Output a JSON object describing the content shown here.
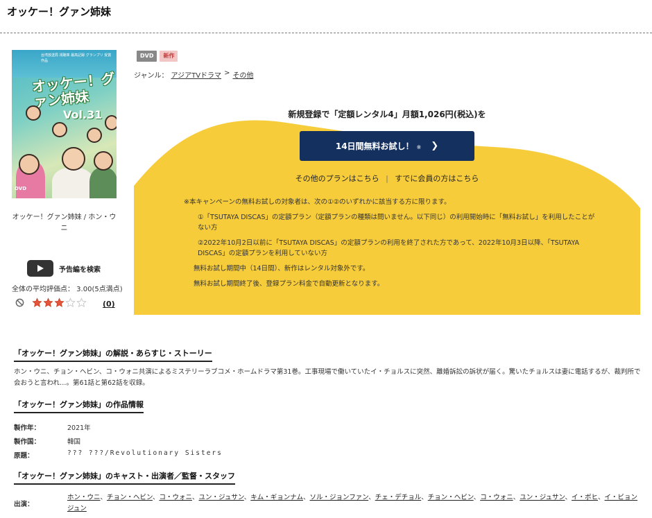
{
  "page": {
    "title": "オッケー！グァン姉妹"
  },
  "cover": {
    "header_text": "台湾放送局 視聴率 最高記録 グランプリ 受賞作品",
    "title_text": "オッケー！グァン姉妹",
    "vol_text": "Vol.31",
    "dvd_mark": "DVD"
  },
  "sidebar": {
    "work_title": "オッケー！グァン姉妹 / ホン・ウニ",
    "trailer_label": "予告編を検索",
    "avg_rating": "全体の平均評価点： 3.00(5点満点)",
    "rating_value": 3,
    "rating_max": 5,
    "review_count": "(0)"
  },
  "badges": {
    "dvd": "DVD",
    "new": "新作"
  },
  "genre": {
    "label": "ジャンル：",
    "item1": "アジアTVドラマ",
    "sep": ">",
    "item2": "その他"
  },
  "campaign": {
    "headline": "新規登録で「定額レンタル4」月額1,026円(税込)を",
    "button_label": "14日間無料お試し！",
    "button_mark": "※",
    "other_plans": "その他のプランはこちら",
    "divider": "|",
    "member_link": "すでに会員の方はこちら",
    "note_intro": "※本キャンペーンの無料お試しの対象者は、次の①②のいずれかに該当する方に限ります。",
    "note1": "①「TSUTAYA DISCAS」の定額プラン（定額プランの種類は問いません。以下同じ）の利用開始時に「無料お試し」を利用したことがない方",
    "note2": "②2022年10月2日以前に「TSUTAYA DISCAS」の定額プランの利用を終了された方であって、2022年10月3日以降、「TSUTAYA DISCAS」の定額プランを利用していない方",
    "note3": "無料お試し期間中（14日間）、新作はレンタル対象外です。",
    "note4": "無料お試し期間終了後、登録プラン料金で自動更新となります。"
  },
  "synopsis": {
    "heading": "「オッケー！グァン姉妹」の解説・あらすじ・ストーリー",
    "text": "ホン・ウニ、チョン・ヘビン、コ・ウォニ共演によるミステリーラブコメ・ホームドラマ第31巻。工事現場で働いていたイ・チョルスに突然、離婚訴訟の訴状が届く。驚いたチョルスは妻に電話するが、裁判所で会おうと言われ…。第61話と第62話を収録。"
  },
  "info": {
    "heading": "「オッケー！グァン姉妹」の作品情報",
    "year_label": "製作年：",
    "year_value": "2021年",
    "country_label": "製作国：",
    "country_value": "韓国",
    "original_label": "原題：",
    "original_value": "??? ???/Revolutionary Sisters"
  },
  "cast": {
    "heading": "「オッケー！グァン姉妹」のキャスト・出演者／監督・スタッフ",
    "label": "出演：",
    "names": [
      "ホン・ウニ",
      "チョン・ヘビン",
      "コ・ウォニ",
      "ユン・ジュサン",
      "キム・ギョンナム",
      "ソル・ジョンファン",
      "チェ・デチョル",
      "チョン・ヘビン",
      "コ・ウォニ",
      "ユン・ジュサン",
      "イ・ボヒ",
      "イ・ビョンジュン"
    ]
  },
  "colors": {
    "campaign_yellow": "#f7cc3b",
    "button_navy": "#14305e",
    "star_red": "#e4553a"
  }
}
